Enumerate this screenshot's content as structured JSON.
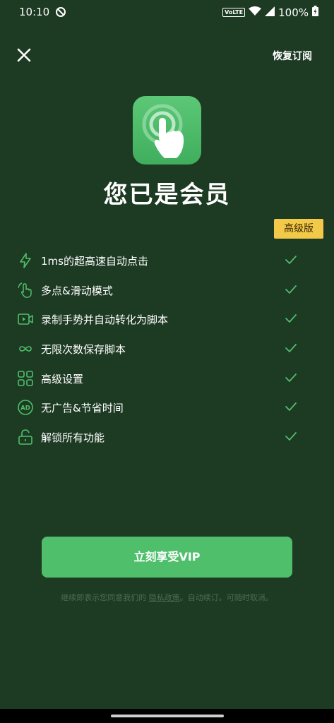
{
  "status_bar": {
    "time": "10:10",
    "network_badge": "VoLTE",
    "battery": "100%"
  },
  "header": {
    "close_icon": "close-icon",
    "restore_label": "恢复订阅"
  },
  "hero": {
    "icon": "tap-hand-icon",
    "title": "您已是会员",
    "badge": "高级版"
  },
  "features": [
    {
      "icon": "lightning-icon",
      "label": "1ms的超高速自动点击"
    },
    {
      "icon": "multi-touch-icon",
      "label": "多点&滑动模式"
    },
    {
      "icon": "video-record-icon",
      "label": "录制手势并自动转化为脚本"
    },
    {
      "icon": "infinity-icon",
      "label": "无限次数保存脚本"
    },
    {
      "icon": "grid-settings-icon",
      "label": "高级设置"
    },
    {
      "icon": "ad-free-icon",
      "label": "无广告&节省时间"
    },
    {
      "icon": "unlock-icon",
      "label": "解锁所有功能"
    }
  ],
  "cta": {
    "label": "立刻享受VIP"
  },
  "legal": {
    "prefix": "继续即表示您同意我们的 ",
    "privacy_link": "隐私政策",
    "suffix": "。自动续订。可随时取消。"
  },
  "colors": {
    "background": "#1d3a23",
    "accent_green": "#4fbf6c",
    "badge_gold": "#f3c94a",
    "icon_green": "#5cc877",
    "check_green": "#4fbf6c"
  }
}
